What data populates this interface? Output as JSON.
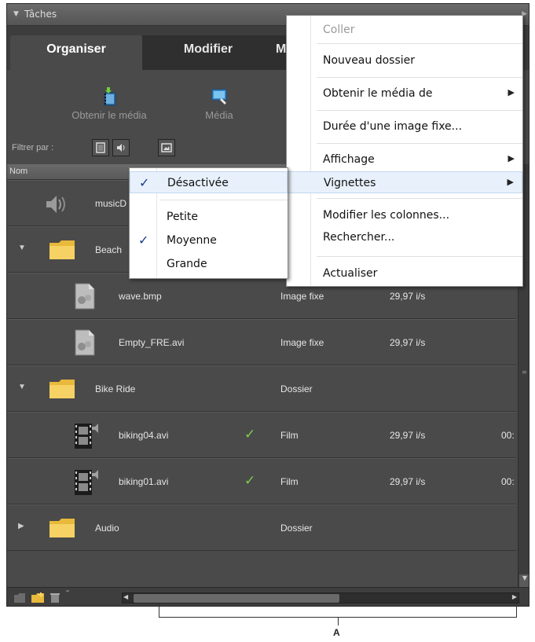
{
  "panel": {
    "title": "Tâches"
  },
  "tabs": [
    {
      "label": "Organiser",
      "active": true
    },
    {
      "label": "Modifier",
      "active": false
    },
    {
      "label": "M",
      "active": false
    }
  ],
  "toolbar": {
    "get_media": "Obtenir le média",
    "media": "Média"
  },
  "filter": {
    "label": "Filtrer par :"
  },
  "columns": {
    "name": "Nom"
  },
  "rows": [
    {
      "name": "musicD",
      "type": "",
      "rate": "",
      "duration": "",
      "kind": "audio"
    },
    {
      "name": "Beach",
      "type": "",
      "rate": "",
      "duration": "",
      "kind": "folder"
    },
    {
      "name": "wave.bmp",
      "type": "Image fixe",
      "rate": "29,97 i/s",
      "duration": "",
      "kind": "image"
    },
    {
      "name": "Empty_FRE.avi",
      "type": "Image fixe",
      "rate": "29,97 i/s",
      "duration": "",
      "kind": "image"
    },
    {
      "name": "Bike Ride",
      "type": "Dossier",
      "rate": "",
      "duration": "",
      "kind": "folder"
    },
    {
      "name": "biking04.avi",
      "type": "Film",
      "rate": "29,97 i/s",
      "duration": "00:",
      "kind": "film"
    },
    {
      "name": "biking01.avi",
      "type": "Film",
      "rate": "29,97 i/s",
      "duration": "00:",
      "kind": "film"
    },
    {
      "name": "Audio",
      "type": "Dossier",
      "rate": "",
      "duration": "",
      "kind": "folder"
    }
  ],
  "context_menu": {
    "items": [
      {
        "label": "Coller",
        "disabled": true
      },
      {
        "label": "Nouveau dossier"
      },
      {
        "label": "Obtenir le média de"
      },
      {
        "label": "Durée d'une image fixe..."
      },
      {
        "label": "Affichage"
      },
      {
        "label": "Vignettes"
      },
      {
        "label": "Modifier les colonnes..."
      },
      {
        "label": "Rechercher..."
      },
      {
        "label": "Actualiser"
      }
    ]
  },
  "submenu": {
    "items": [
      {
        "label": "Désactivée",
        "checked": true
      },
      {
        "label": "Petite",
        "checked": false
      },
      {
        "label": "Moyenne",
        "checked": true
      },
      {
        "label": "Grande",
        "checked": false
      }
    ]
  },
  "callout": {
    "label": "A"
  },
  "colors": {
    "panel_bg": "#4a4a4a",
    "check_green": "#7ecf4a",
    "menu_highlight": "#e8f1fb"
  }
}
